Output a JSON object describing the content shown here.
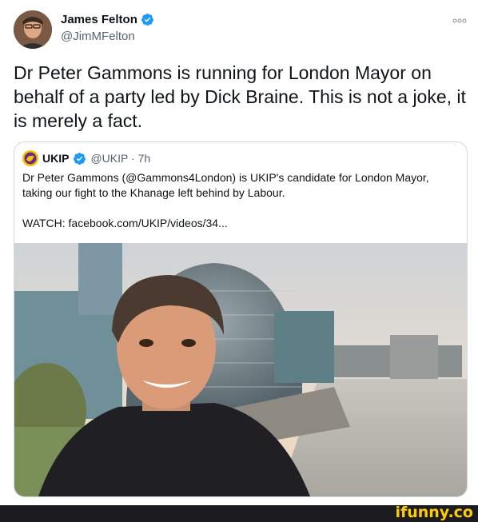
{
  "tweet": {
    "author_name": "James Felton",
    "author_handle": "@JimMFelton",
    "text": "Dr Peter Gammons is running for London Mayor on behalf of a party led by Dick Braine. This is not a joke, it is merely a fact."
  },
  "quoted_tweet": {
    "author_name": "UKIP",
    "handle_time": "@UKIP · 7h",
    "text_line1": "Dr Peter Gammons (@Gammons4London) is UKIP's candidate for London Mayor, taking our fight to the Khanage left behind by Labour.",
    "text_line2": "WATCH: facebook.com/UKIP/videos/34..."
  },
  "icons": {
    "verified": "verified-badge-icon",
    "more": "more-options-icon",
    "ukip_avatar": "ukip-lion-logo"
  },
  "colors": {
    "verified": "#1d9bf0",
    "ukip": "#f5c400",
    "watermark": "#ffcc00"
  },
  "watermark": {
    "text": "ifunny.co"
  }
}
